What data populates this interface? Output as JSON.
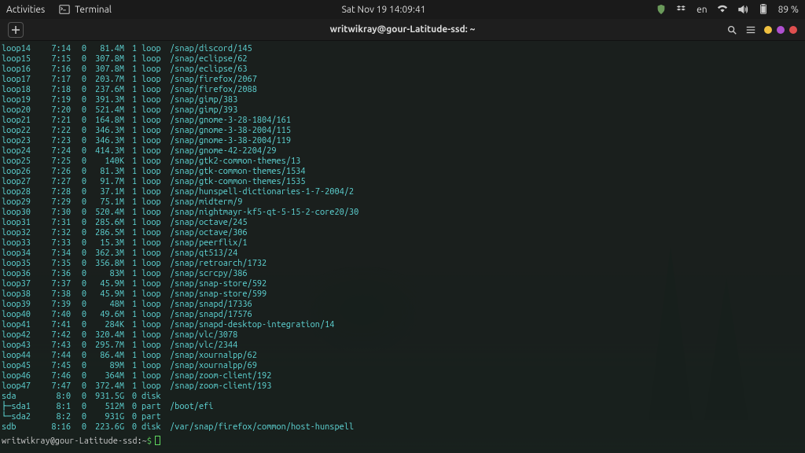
{
  "topbar": {
    "activities": "Activities",
    "terminal_label": "Terminal",
    "clock": "Sat Nov 19  14:09:41",
    "lang": "en",
    "battery": "89 %"
  },
  "titlebar": {
    "title": "writwikray@gour-Latitude-ssd: ~"
  },
  "rows": [
    {
      "name": "loop14",
      "mm": "7:14",
      "rm": "0",
      "size": "81.4M",
      "ro": "1",
      "type": "loop",
      "mnt": "/snap/discord/145"
    },
    {
      "name": "loop15",
      "mm": "7:15",
      "rm": "0",
      "size": "307.8M",
      "ro": "1",
      "type": "loop",
      "mnt": "/snap/eclipse/62"
    },
    {
      "name": "loop16",
      "mm": "7:16",
      "rm": "0",
      "size": "307.8M",
      "ro": "1",
      "type": "loop",
      "mnt": "/snap/eclipse/63"
    },
    {
      "name": "loop17",
      "mm": "7:17",
      "rm": "0",
      "size": "203.7M",
      "ro": "1",
      "type": "loop",
      "mnt": "/snap/firefox/2067"
    },
    {
      "name": "loop18",
      "mm": "7:18",
      "rm": "0",
      "size": "237.6M",
      "ro": "1",
      "type": "loop",
      "mnt": "/snap/firefox/2088"
    },
    {
      "name": "loop19",
      "mm": "7:19",
      "rm": "0",
      "size": "391.3M",
      "ro": "1",
      "type": "loop",
      "mnt": "/snap/gimp/383"
    },
    {
      "name": "loop20",
      "mm": "7:20",
      "rm": "0",
      "size": "521.4M",
      "ro": "1",
      "type": "loop",
      "mnt": "/snap/gimp/393"
    },
    {
      "name": "loop21",
      "mm": "7:21",
      "rm": "0",
      "size": "164.8M",
      "ro": "1",
      "type": "loop",
      "mnt": "/snap/gnome-3-28-1804/161"
    },
    {
      "name": "loop22",
      "mm": "7:22",
      "rm": "0",
      "size": "346.3M",
      "ro": "1",
      "type": "loop",
      "mnt": "/snap/gnome-3-38-2004/115"
    },
    {
      "name": "loop23",
      "mm": "7:23",
      "rm": "0",
      "size": "346.3M",
      "ro": "1",
      "type": "loop",
      "mnt": "/snap/gnome-3-38-2004/119"
    },
    {
      "name": "loop24",
      "mm": "7:24",
      "rm": "0",
      "size": "414.3M",
      "ro": "1",
      "type": "loop",
      "mnt": "/snap/gnome-42-2204/29"
    },
    {
      "name": "loop25",
      "mm": "7:25",
      "rm": "0",
      "size": "140K",
      "ro": "1",
      "type": "loop",
      "mnt": "/snap/gtk2-common-themes/13"
    },
    {
      "name": "loop26",
      "mm": "7:26",
      "rm": "0",
      "size": "81.3M",
      "ro": "1",
      "type": "loop",
      "mnt": "/snap/gtk-common-themes/1534"
    },
    {
      "name": "loop27",
      "mm": "7:27",
      "rm": "0",
      "size": "91.7M",
      "ro": "1",
      "type": "loop",
      "mnt": "/snap/gtk-common-themes/1535"
    },
    {
      "name": "loop28",
      "mm": "7:28",
      "rm": "0",
      "size": "37.1M",
      "ro": "1",
      "type": "loop",
      "mnt": "/snap/hunspell-dictionaries-1-7-2004/2"
    },
    {
      "name": "loop29",
      "mm": "7:29",
      "rm": "0",
      "size": "75.1M",
      "ro": "1",
      "type": "loop",
      "mnt": "/snap/midterm/9"
    },
    {
      "name": "loop30",
      "mm": "7:30",
      "rm": "0",
      "size": "520.4M",
      "ro": "1",
      "type": "loop",
      "mnt": "/snap/nightmayr-kf5-qt-5-15-2-core20/30"
    },
    {
      "name": "loop31",
      "mm": "7:31",
      "rm": "0",
      "size": "285.6M",
      "ro": "1",
      "type": "loop",
      "mnt": "/snap/octave/245"
    },
    {
      "name": "loop32",
      "mm": "7:32",
      "rm": "0",
      "size": "286.5M",
      "ro": "1",
      "type": "loop",
      "mnt": "/snap/octave/306"
    },
    {
      "name": "loop33",
      "mm": "7:33",
      "rm": "0",
      "size": "15.3M",
      "ro": "1",
      "type": "loop",
      "mnt": "/snap/peerflix/1"
    },
    {
      "name": "loop34",
      "mm": "7:34",
      "rm": "0",
      "size": "362.3M",
      "ro": "1",
      "type": "loop",
      "mnt": "/snap/qt513/24"
    },
    {
      "name": "loop35",
      "mm": "7:35",
      "rm": "0",
      "size": "356.8M",
      "ro": "1",
      "type": "loop",
      "mnt": "/snap/retroarch/1732"
    },
    {
      "name": "loop36",
      "mm": "7:36",
      "rm": "0",
      "size": "83M",
      "ro": "1",
      "type": "loop",
      "mnt": "/snap/scrcpy/386"
    },
    {
      "name": "loop37",
      "mm": "7:37",
      "rm": "0",
      "size": "45.9M",
      "ro": "1",
      "type": "loop",
      "mnt": "/snap/snap-store/592"
    },
    {
      "name": "loop38",
      "mm": "7:38",
      "rm": "0",
      "size": "45.9M",
      "ro": "1",
      "type": "loop",
      "mnt": "/snap/snap-store/599"
    },
    {
      "name": "loop39",
      "mm": "7:39",
      "rm": "0",
      "size": "48M",
      "ro": "1",
      "type": "loop",
      "mnt": "/snap/snapd/17336"
    },
    {
      "name": "loop40",
      "mm": "7:40",
      "rm": "0",
      "size": "49.6M",
      "ro": "1",
      "type": "loop",
      "mnt": "/snap/snapd/17576"
    },
    {
      "name": "loop41",
      "mm": "7:41",
      "rm": "0",
      "size": "284K",
      "ro": "1",
      "type": "loop",
      "mnt": "/snap/snapd-desktop-integration/14"
    },
    {
      "name": "loop42",
      "mm": "7:42",
      "rm": "0",
      "size": "320.4M",
      "ro": "1",
      "type": "loop",
      "mnt": "/snap/vlc/3078"
    },
    {
      "name": "loop43",
      "mm": "7:43",
      "rm": "0",
      "size": "295.7M",
      "ro": "1",
      "type": "loop",
      "mnt": "/snap/vlc/2344"
    },
    {
      "name": "loop44",
      "mm": "7:44",
      "rm": "0",
      "size": "86.4M",
      "ro": "1",
      "type": "loop",
      "mnt": "/snap/xournalpp/62"
    },
    {
      "name": "loop45",
      "mm": "7:45",
      "rm": "0",
      "size": "89M",
      "ro": "1",
      "type": "loop",
      "mnt": "/snap/xournalpp/69"
    },
    {
      "name": "loop46",
      "mm": "7:46",
      "rm": "0",
      "size": "364M",
      "ro": "1",
      "type": "loop",
      "mnt": "/snap/zoom-client/192"
    },
    {
      "name": "loop47",
      "mm": "7:47",
      "rm": "0",
      "size": "372.4M",
      "ro": "1",
      "type": "loop",
      "mnt": "/snap/zoom-client/193"
    },
    {
      "name": "sda",
      "mm": "8:0",
      "rm": "0",
      "size": "931.5G",
      "ro": "0",
      "type": "disk",
      "mnt": ""
    },
    {
      "name": "├─sda1",
      "mm": "8:1",
      "rm": "0",
      "size": "512M",
      "ro": "0",
      "type": "part",
      "mnt": "/boot/efi"
    },
    {
      "name": "└─sda2",
      "mm": "8:2",
      "rm": "0",
      "size": "931G",
      "ro": "0",
      "type": "part",
      "mnt": ""
    },
    {
      "name": "sdb",
      "mm": "8:16",
      "rm": "0",
      "size": "223.6G",
      "ro": "0",
      "type": "disk",
      "mnt": "/var/snap/firefox/common/host-hunspell"
    }
  ],
  "prompt": {
    "user": "writwikray",
    "at": "@",
    "host": "gour-Latitude-ssd",
    "colon": ":",
    "path": "~",
    "dollar": "$"
  }
}
